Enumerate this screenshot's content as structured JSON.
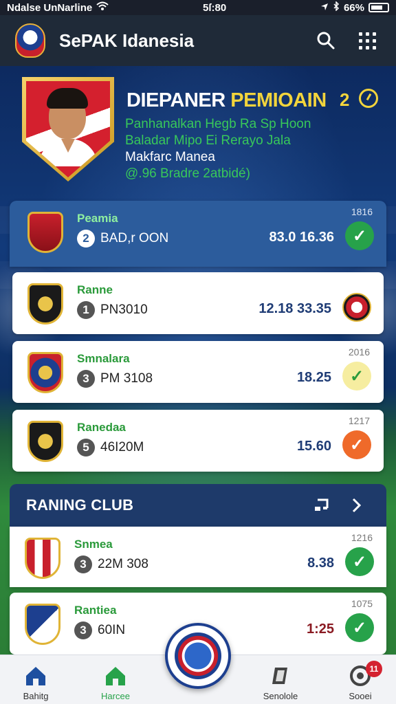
{
  "status_bar": {
    "carrier": "Ndalse UnNarline",
    "time": "5ſ:80",
    "battery": "66%"
  },
  "header": {
    "title": "SePAK Idanesia"
  },
  "hero": {
    "title_a": "DIEPANER",
    "title_b": "PEMIOAIN",
    "number": "2",
    "line1": "Panhanalkan Hegb Ra Sp Hoon",
    "line2": "Baladar Mipo Ei Rerayo Jala",
    "line3": "Makfarc Manea",
    "line4": "@.96 Bradre 2atbidé)"
  },
  "matches": [
    {
      "team": "Peamia",
      "rank": "2",
      "label": "BAD,r OON",
      "value": "83.0 16.36",
      "meta": "1816",
      "status": "check"
    },
    {
      "team": "Ranne",
      "rank": "1",
      "label": "PN3010",
      "value": "12.18 33.35",
      "meta": "",
      "status": "opponent-crest"
    },
    {
      "team": "Smnalara",
      "rank": "3",
      "label": "PM 3108",
      "value": "18.25",
      "meta": "2016",
      "status": "check"
    },
    {
      "team": "Ranedaa",
      "rank": "5",
      "label": "46I20M",
      "value": "15.60",
      "meta": "1217",
      "status": "check"
    }
  ],
  "ranking": {
    "title": "RANING CLUB",
    "rows": [
      {
        "team": "Snmea",
        "rank": "3",
        "label": "22M 308",
        "value": "8.38",
        "meta": "1216",
        "status": "check"
      },
      {
        "team": "Rantiea",
        "rank": "3",
        "label": "60IN",
        "value": "1:25",
        "meta": "1075",
        "status": "check"
      }
    ]
  },
  "bottom_nav": {
    "items": [
      {
        "label": "Bahitg",
        "icon": "home-icon"
      },
      {
        "label": "Harcee",
        "icon": "home-icon"
      },
      {
        "label": "Senolole",
        "icon": "cube-icon"
      },
      {
        "label": "Sooei",
        "icon": "gear-icon"
      }
    ],
    "notification_count": "11"
  },
  "colors": {
    "header_bg": "#1f2a38",
    "accent_yellow": "#f2d43c",
    "accent_green": "#27a24a",
    "accent_orange": "#ef6a2a",
    "panel_blue": "#1e3a6a"
  }
}
